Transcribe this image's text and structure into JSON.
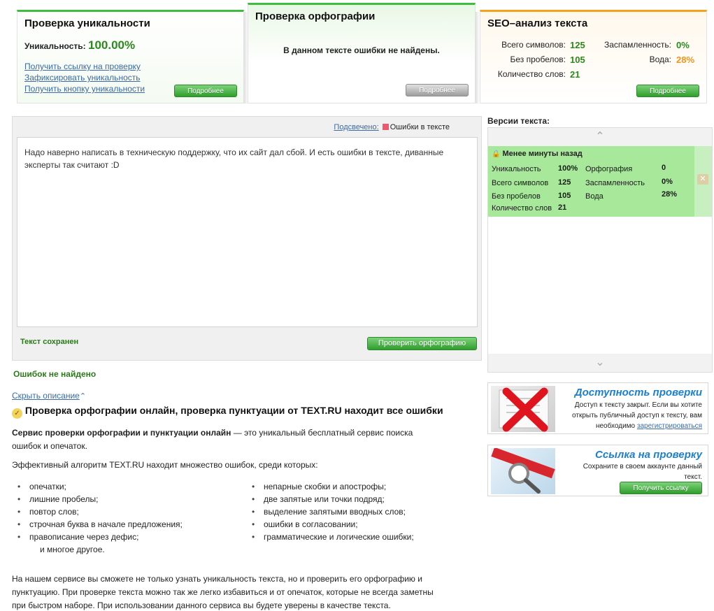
{
  "uniqueness": {
    "title": "Проверка уникальности",
    "label": "Уникальность:",
    "value": "100.00%",
    "links": [
      "Получить ссылку на проверку",
      "Зафиксировать уникальность",
      "Получить кнопку уникальности"
    ],
    "button": "Подробнее"
  },
  "spelling": {
    "title": "Проверка орфографии",
    "message": "В данном тексте ошибки не найдены.",
    "button": "Подробнее"
  },
  "seo": {
    "title": "SEO–анализ текста",
    "total_chars_label": "Всего символов:",
    "total_chars": "125",
    "no_spaces_label": "Без пробелов:",
    "no_spaces": "105",
    "words_label": "Количество слов:",
    "words": "21",
    "spam_label": "Заспамленность:",
    "spam": "0%",
    "water_label": "Вода:",
    "water": "28%",
    "button": "Подробнее"
  },
  "editor": {
    "highlighted_label": "Подсвечено:",
    "legend_label": "Ошибки в тексте",
    "text": "Надо наверно написать в техническую поддержку, что их сайт дал сбой. И есть ошибки в тексте, диванные эксперты так считают :D",
    "saved": "Текст сохранен",
    "check_button": "Проверить орфографию",
    "no_errors": "Ошибок не найдено"
  },
  "versions": {
    "title": "Версии текста:",
    "item": {
      "time": "Менее минуты назад",
      "uniq_label": "Уникальность",
      "uniq": "100%",
      "spell_label": "Орфография",
      "spell": "0",
      "chars_label": "Всего символов",
      "chars": "125",
      "spam_label": "Заспамленность",
      "spam": "0%",
      "nospace_label": "Без пробелов",
      "nospace": "105",
      "water_label": "Вода",
      "water": "28%",
      "words_label": "Количество слов",
      "words": "21"
    }
  },
  "promo_access": {
    "title": "Доступность проверки",
    "text1": "Доступ к тексту закрыт. Если вы хотите",
    "text2": "открыть публичный доступ к тексту, вам",
    "text3": "необходимо",
    "link": "зарегистрироваться"
  },
  "promo_link": {
    "title": "Ссылка на проверку",
    "text1": "Сохраните в своем аккаунте данный",
    "text2": "текст.",
    "button": "Получить ссылку"
  },
  "description": {
    "toggle": "Скрыть описание",
    "heading": "Проверка орфографии онлайн, проверка пунктуации от TEXT.RU находит все ошибки",
    "intro_bold": "Сервис проверки орфографии и пунктуации онлайн",
    "intro_rest": " — это уникальный бесплатный сервис поиска",
    "intro_line2": "ошибок и опечаток.",
    "algo": "Эффективный алгоритм TEXT.RU находит множество ошибок, среди которых:",
    "list_left": [
      "опечатки;",
      "лишние пробелы;",
      "повтор слов;",
      "строчная буква в начале предложения;",
      "правописание через дефис;"
    ],
    "list_left_extra": "и многое другое.",
    "list_right": [
      "непарные скобки и апострофы;",
      "две запятые или точки подряд;",
      "выделение запятыми вводных слов;",
      "ошибки в согласовании;",
      "грамматические и логические ошибки;"
    ],
    "final_1": "На нашем сервисе вы сможете не только узнать уникальность текста, но и проверить его орфографию и",
    "final_2": "пунктуацию. При проверке текста можно так же легко избавиться и от опечаток, которые не всегда заметны",
    "final_3": "при быстром наборе. При использовании данного сервиса вы будете уверены в качестве текста."
  }
}
